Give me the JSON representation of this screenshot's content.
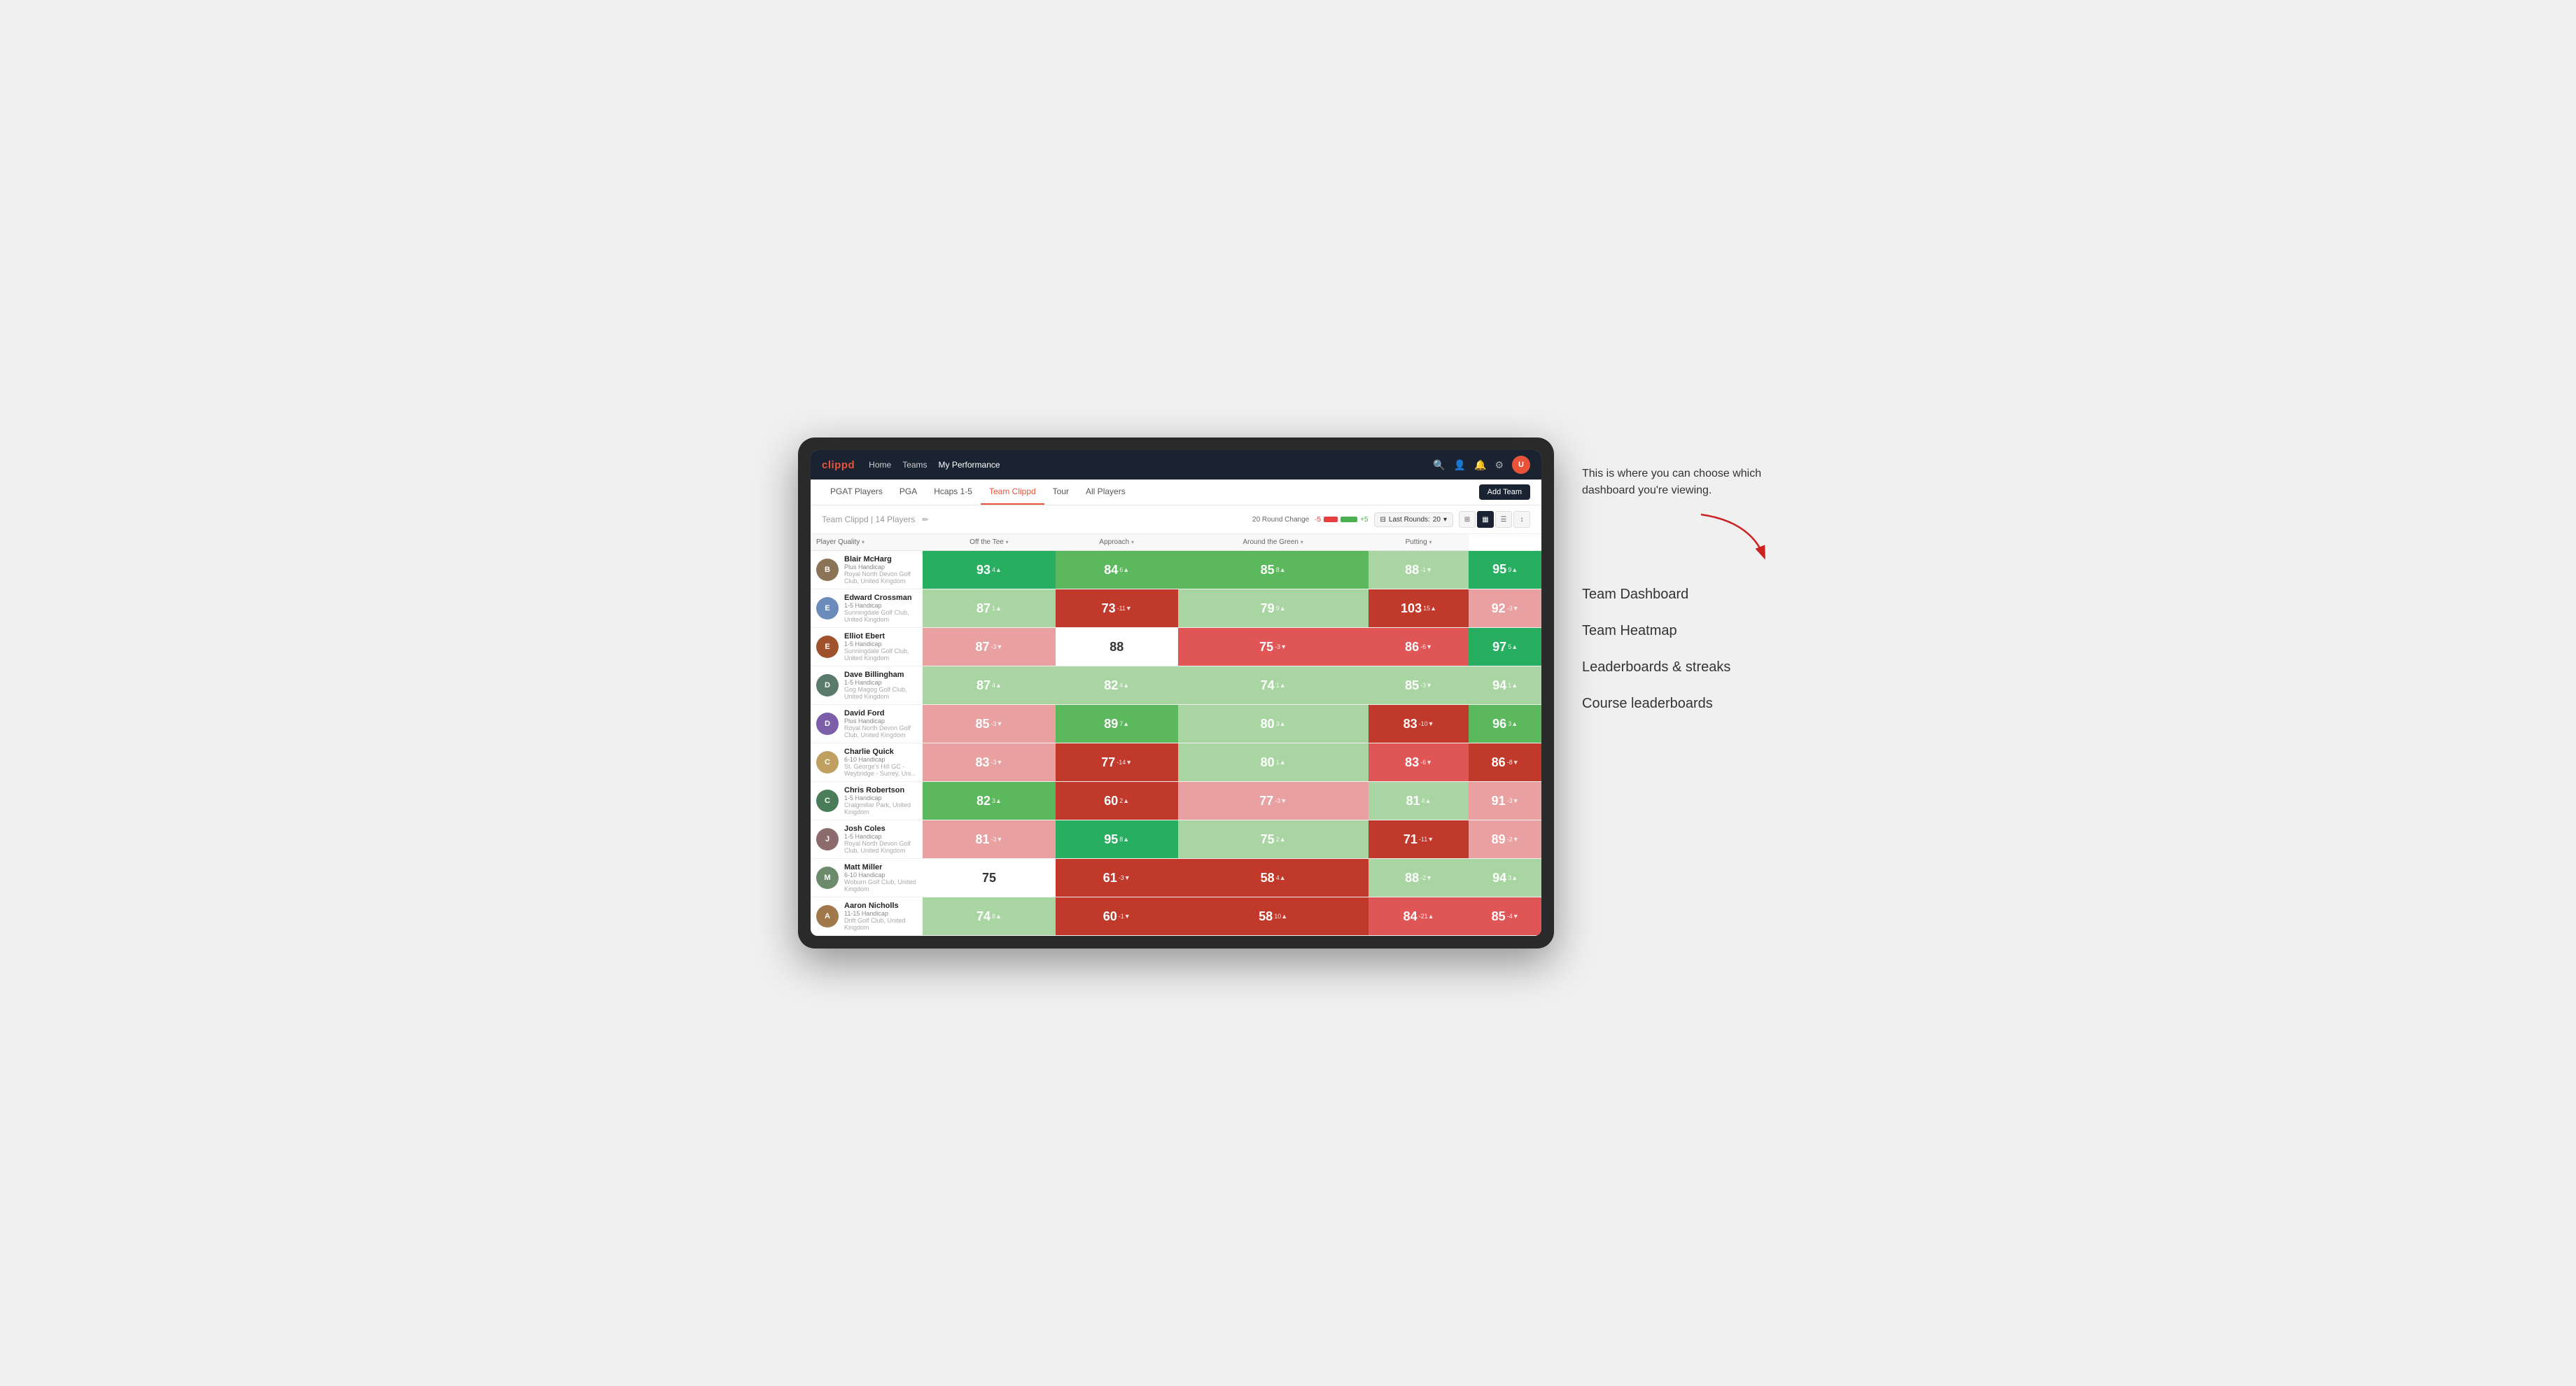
{
  "annotation": {
    "tooltip_text": "This is where you can choose which dashboard you're viewing.",
    "items": [
      {
        "label": "Team Dashboard"
      },
      {
        "label": "Team Heatmap"
      },
      {
        "label": "Leaderboards & streaks"
      },
      {
        "label": "Course leaderboards"
      }
    ]
  },
  "nav": {
    "logo": "clippd",
    "links": [
      {
        "label": "Home",
        "active": false
      },
      {
        "label": "Teams",
        "active": false
      },
      {
        "label": "My Performance",
        "active": true
      }
    ],
    "add_team_label": "Add Team"
  },
  "sub_nav": {
    "links": [
      {
        "label": "PGAT Players",
        "active": false
      },
      {
        "label": "PGA",
        "active": false
      },
      {
        "label": "Hcaps 1-5",
        "active": false
      },
      {
        "label": "Team Clippd",
        "active": true
      },
      {
        "label": "Tour",
        "active": false
      },
      {
        "label": "All Players",
        "active": false
      }
    ]
  },
  "team_header": {
    "title": "Team Clippd",
    "count": "14 Players",
    "round_change_label": "20 Round Change",
    "neg_label": "-5",
    "pos_label": "+5",
    "last_rounds_label": "Last Rounds:",
    "last_rounds_value": "20"
  },
  "table": {
    "columns": [
      {
        "label": "Player Quality",
        "sort": true
      },
      {
        "label": "Off the Tee",
        "sort": true
      },
      {
        "label": "Approach",
        "sort": true
      },
      {
        "label": "Around the Green",
        "sort": true
      },
      {
        "label": "Putting",
        "sort": true
      }
    ],
    "players": [
      {
        "name": "Blair McHarg",
        "handicap": "Plus Handicap",
        "club": "Royal North Devon Golf Club, United Kingdom",
        "avatar_color": "#8b7355",
        "scores": [
          {
            "value": 93,
            "change": "4▲",
            "bg": "green-strong"
          },
          {
            "value": 84,
            "change": "6▲",
            "bg": "green-mid"
          },
          {
            "value": 85,
            "change": "8▲",
            "bg": "green-mid"
          },
          {
            "value": 88,
            "change": "-1▼",
            "bg": "green-light"
          },
          {
            "value": 95,
            "change": "9▲",
            "bg": "green-strong"
          }
        ]
      },
      {
        "name": "Edward Crossman",
        "handicap": "1-5 Handicap",
        "club": "Sunningdale Golf Club, United Kingdom",
        "avatar_color": "#6b8cba",
        "scores": [
          {
            "value": 87,
            "change": "1▲",
            "bg": "green-light"
          },
          {
            "value": 73,
            "change": "-11▼",
            "bg": "red-strong"
          },
          {
            "value": 79,
            "change": "9▲",
            "bg": "green-light"
          },
          {
            "value": 103,
            "change": "15▲",
            "bg": "red-strong"
          },
          {
            "value": 92,
            "change": "-3▼",
            "bg": "red-light"
          }
        ]
      },
      {
        "name": "Elliot Ebert",
        "handicap": "1-5 Handicap",
        "club": "Sunningdale Golf Club, United Kingdom",
        "avatar_color": "#a0522d",
        "scores": [
          {
            "value": 87,
            "change": "-3▼",
            "bg": "red-light"
          },
          {
            "value": 88,
            "change": "",
            "bg": "white"
          },
          {
            "value": 75,
            "change": "-3▼",
            "bg": "red-mid"
          },
          {
            "value": 86,
            "change": "-6▼",
            "bg": "red-mid"
          },
          {
            "value": 97,
            "change": "5▲",
            "bg": "green-strong"
          }
        ]
      },
      {
        "name": "Dave Billingham",
        "handicap": "1-5 Handicap",
        "club": "Gog Magog Golf Club, United Kingdom",
        "avatar_color": "#5a7a6b",
        "scores": [
          {
            "value": 87,
            "change": "4▲",
            "bg": "green-light"
          },
          {
            "value": 82,
            "change": "4▲",
            "bg": "green-light"
          },
          {
            "value": 74,
            "change": "1▲",
            "bg": "green-light"
          },
          {
            "value": 85,
            "change": "-3▼",
            "bg": "green-light"
          },
          {
            "value": 94,
            "change": "1▲",
            "bg": "green-light"
          }
        ]
      },
      {
        "name": "David Ford",
        "handicap": "Plus Handicap",
        "club": "Royal North Devon Golf Club, United Kingdom",
        "avatar_color": "#7b5ea7",
        "scores": [
          {
            "value": 85,
            "change": "-3▼",
            "bg": "red-light"
          },
          {
            "value": 89,
            "change": "7▲",
            "bg": "green-mid"
          },
          {
            "value": 80,
            "change": "3▲",
            "bg": "green-light"
          },
          {
            "value": 83,
            "change": "-10▼",
            "bg": "red-strong"
          },
          {
            "value": 96,
            "change": "3▲",
            "bg": "green-mid"
          }
        ]
      },
      {
        "name": "Charlie Quick",
        "handicap": "6-10 Handicap",
        "club": "St. George's Hill GC - Weybridge - Surrey, Uni...",
        "avatar_color": "#c0a060",
        "scores": [
          {
            "value": 83,
            "change": "-3▼",
            "bg": "red-light"
          },
          {
            "value": 77,
            "change": "-14▼",
            "bg": "red-strong"
          },
          {
            "value": 80,
            "change": "1▲",
            "bg": "green-light"
          },
          {
            "value": 83,
            "change": "-6▼",
            "bg": "red-mid"
          },
          {
            "value": 86,
            "change": "-8▼",
            "bg": "red-strong"
          }
        ]
      },
      {
        "name": "Chris Robertson",
        "handicap": "1-5 Handicap",
        "club": "Craigmillar Park, United Kingdom",
        "avatar_color": "#4a7c59",
        "scores": [
          {
            "value": 82,
            "change": "3▲",
            "bg": "green-mid"
          },
          {
            "value": 60,
            "change": "2▲",
            "bg": "red-strong"
          },
          {
            "value": 77,
            "change": "-3▼",
            "bg": "red-light"
          },
          {
            "value": 81,
            "change": "4▲",
            "bg": "green-light"
          },
          {
            "value": 91,
            "change": "-3▼",
            "bg": "red-light"
          }
        ]
      },
      {
        "name": "Josh Coles",
        "handicap": "1-5 Handicap",
        "club": "Royal North Devon Golf Club, United Kingdom",
        "avatar_color": "#8b6b6b",
        "scores": [
          {
            "value": 81,
            "change": "-3▼",
            "bg": "red-light"
          },
          {
            "value": 95,
            "change": "8▲",
            "bg": "green-strong"
          },
          {
            "value": 75,
            "change": "2▲",
            "bg": "green-light"
          },
          {
            "value": 71,
            "change": "-11▼",
            "bg": "red-strong"
          },
          {
            "value": 89,
            "change": "-2▼",
            "bg": "red-light"
          }
        ]
      },
      {
        "name": "Matt Miller",
        "handicap": "6-10 Handicap",
        "club": "Woburn Golf Club, United Kingdom",
        "avatar_color": "#6b8b6b",
        "scores": [
          {
            "value": 75,
            "change": "",
            "bg": "white"
          },
          {
            "value": 61,
            "change": "-3▼",
            "bg": "red-strong"
          },
          {
            "value": 58,
            "change": "4▲",
            "bg": "red-strong"
          },
          {
            "value": 88,
            "change": "-2▼",
            "bg": "green-light"
          },
          {
            "value": 94,
            "change": "3▲",
            "bg": "green-light"
          }
        ]
      },
      {
        "name": "Aaron Nicholls",
        "handicap": "11-15 Handicap",
        "club": "Drift Golf Club, United Kingdom",
        "avatar_color": "#a0784a",
        "scores": [
          {
            "value": 74,
            "change": "8▲",
            "bg": "green-light"
          },
          {
            "value": 60,
            "change": "-1▼",
            "bg": "red-strong"
          },
          {
            "value": 58,
            "change": "10▲",
            "bg": "red-strong"
          },
          {
            "value": 84,
            "change": "-21▲",
            "bg": "red-mid"
          },
          {
            "value": 85,
            "change": "-4▼",
            "bg": "red-mid"
          }
        ]
      }
    ]
  }
}
